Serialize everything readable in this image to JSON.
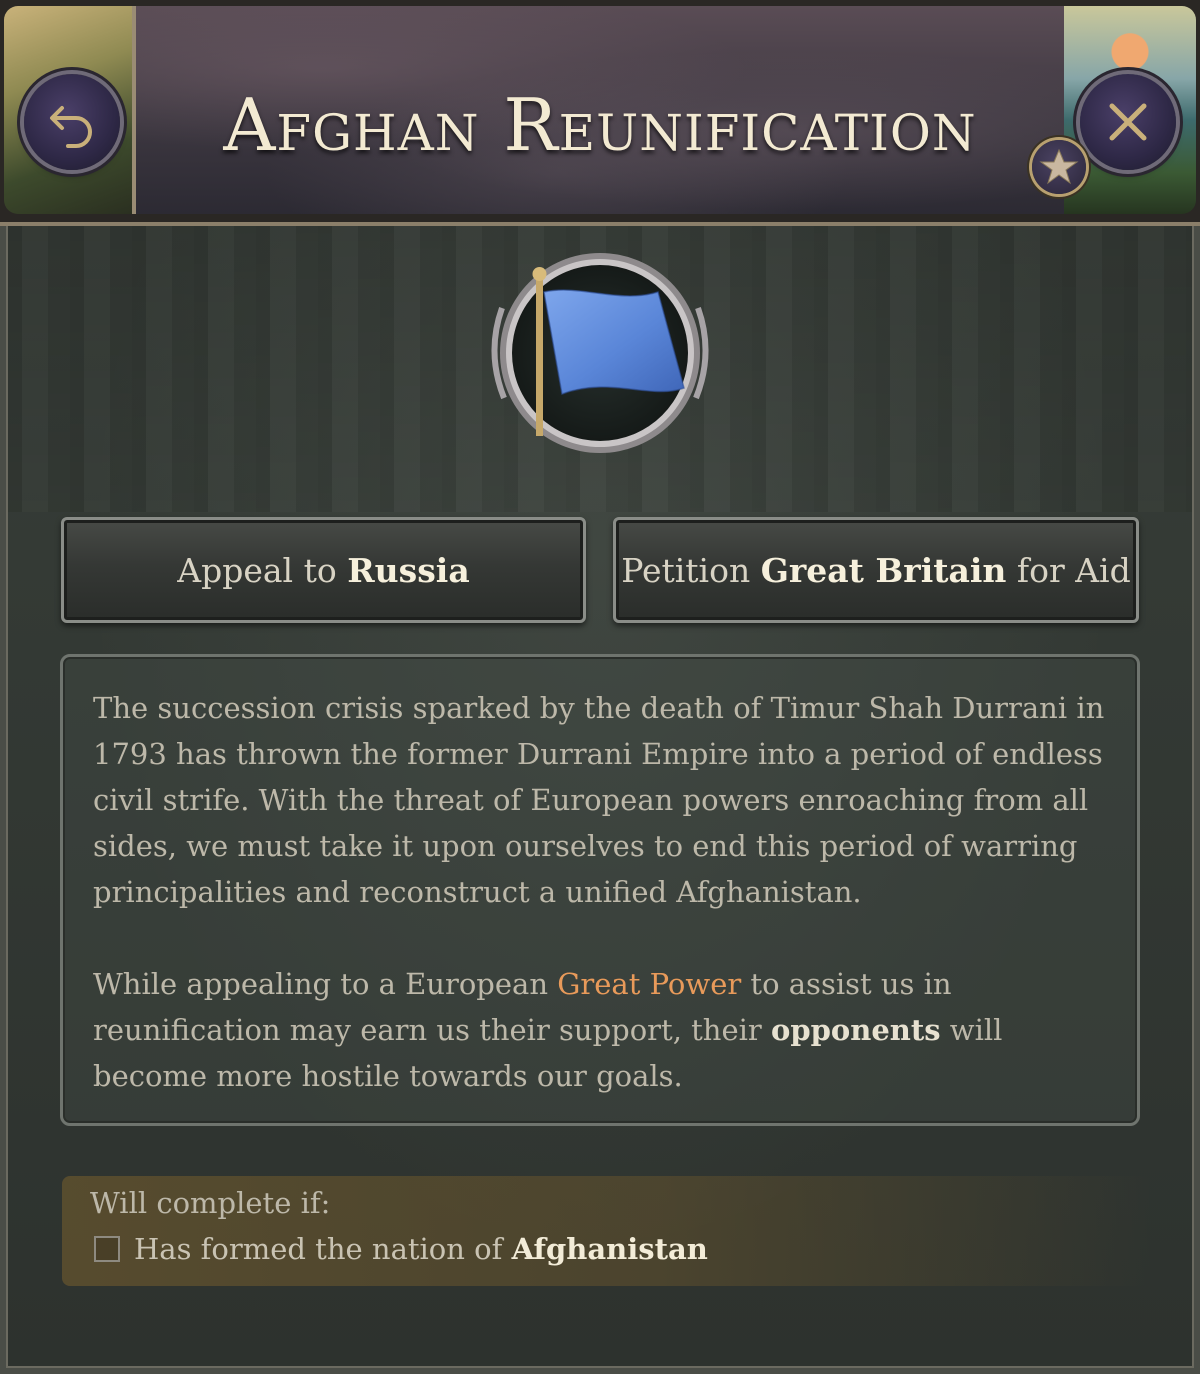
{
  "header": {
    "title": "Afghan Reunification"
  },
  "choices": {
    "russia": {
      "prefix": "Appeal to ",
      "name": "Russia",
      "suffix": ""
    },
    "britain": {
      "prefix": "Petition ",
      "name": "Great Britain",
      "suffix": " for Aid"
    }
  },
  "description": {
    "para1": "The succession crisis sparked by the death of Timur Shah Durrani in 1793 has thrown the former Durrani Empire into a period of endless civil strife. With the threat of European powers enroaching from all sides, we must take it upon ourselves to end this period of warring principalities and reconstruct a unified Afghanistan.",
    "para2_a": "While appealing to a European ",
    "para2_highlight": "Great Power",
    "para2_b": " to assist us in reunification may earn us their support, their ",
    "para2_strong": "opponents",
    "para2_c": " will become more hostile towards our goals."
  },
  "completion": {
    "heading": "Will complete if:",
    "condition_prefix": "Has formed the nation of ",
    "condition_target": "Afghanistan",
    "checked": false
  },
  "colors": {
    "highlight": "#e89a5a",
    "flag": "#5a86d8",
    "title": "#f3ead2"
  },
  "icons": [
    "back-arrow-icon",
    "close-icon",
    "star-icon",
    "flag-icon",
    "checkbox-icon"
  ]
}
